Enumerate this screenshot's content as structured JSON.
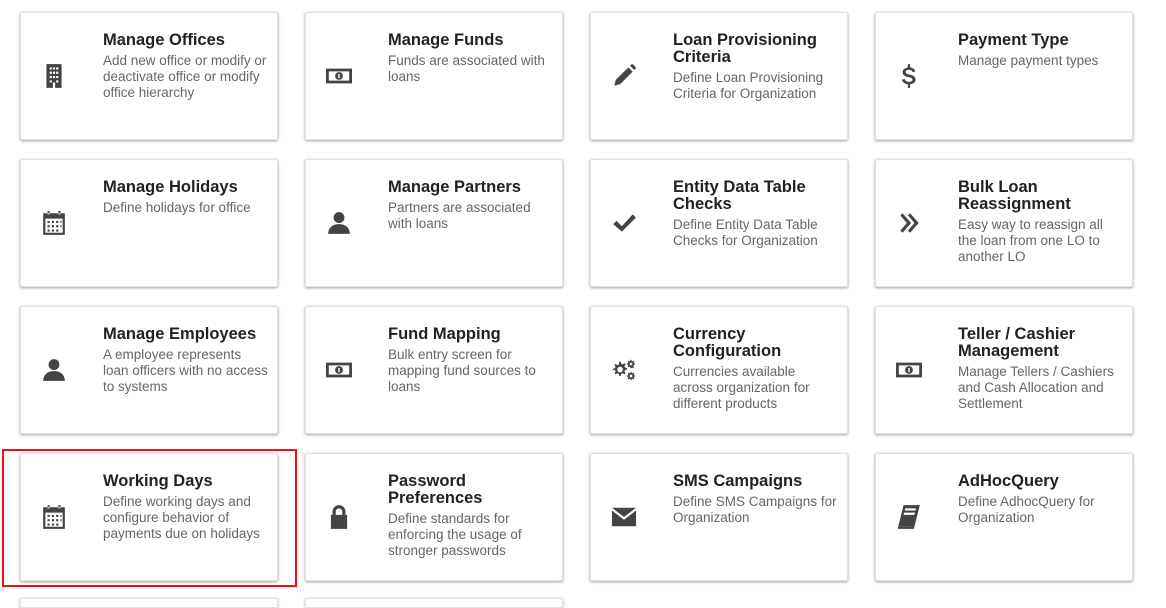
{
  "cards": [
    {
      "title": "Manage Offices",
      "desc": "Add new office or modify or deactivate office or modify office hierarchy",
      "icon": "building-icon"
    },
    {
      "title": "Manage Funds",
      "desc": "Funds are associated with loans",
      "icon": "money-bill-icon"
    },
    {
      "title": "Loan Provisioning Criteria",
      "desc": "Define Loan Provisioning Criteria for Organization",
      "icon": "pencil-icon"
    },
    {
      "title": "Payment Type",
      "desc": "Manage payment types",
      "icon": "dollar-icon"
    },
    {
      "title": "Manage Holidays",
      "desc": "Define holidays for office",
      "icon": "calendar-icon"
    },
    {
      "title": "Manage Partners",
      "desc": "Partners are associated with loans",
      "icon": "user-icon"
    },
    {
      "title": "Entity Data Table Checks",
      "desc": "Define Entity Data Table Checks for Organization",
      "icon": "check-icon"
    },
    {
      "title": "Bulk Loan Reassignment",
      "desc": "Easy way to reassign all the loan from one LO to another LO",
      "icon": "double-chevron-right-icon"
    },
    {
      "title": "Manage Employees",
      "desc": "A employee represents loan officers with no access to systems",
      "icon": "user-icon"
    },
    {
      "title": "Fund Mapping",
      "desc": "Bulk entry screen for mapping fund sources to loans",
      "icon": "money-bill-icon"
    },
    {
      "title": "Currency Configuration",
      "desc": "Currencies available across organization for different products",
      "icon": "gears-icon"
    },
    {
      "title": "Teller / Cashier Management",
      "desc": "Manage Tellers / Cashiers and Cash Allocation and Settlement",
      "icon": "money-bill-icon"
    },
    {
      "title": "Working Days",
      "desc": "Define working days and configure behavior of payments due on holidays",
      "icon": "calendar-icon"
    },
    {
      "title": "Password Preferences",
      "desc": "Define standards for enforcing the usage of stronger passwords",
      "icon": "lock-icon"
    },
    {
      "title": "SMS Campaigns",
      "desc": "Define SMS Campaigns for Organization",
      "icon": "envelope-icon"
    },
    {
      "title": "AdHocQuery",
      "desc": "Define AdhocQuery for Organization",
      "icon": "book-icon"
    }
  ],
  "colors": {
    "highlight": "#e11111",
    "icon": "#444444",
    "title": "#222222",
    "desc": "#666666"
  }
}
